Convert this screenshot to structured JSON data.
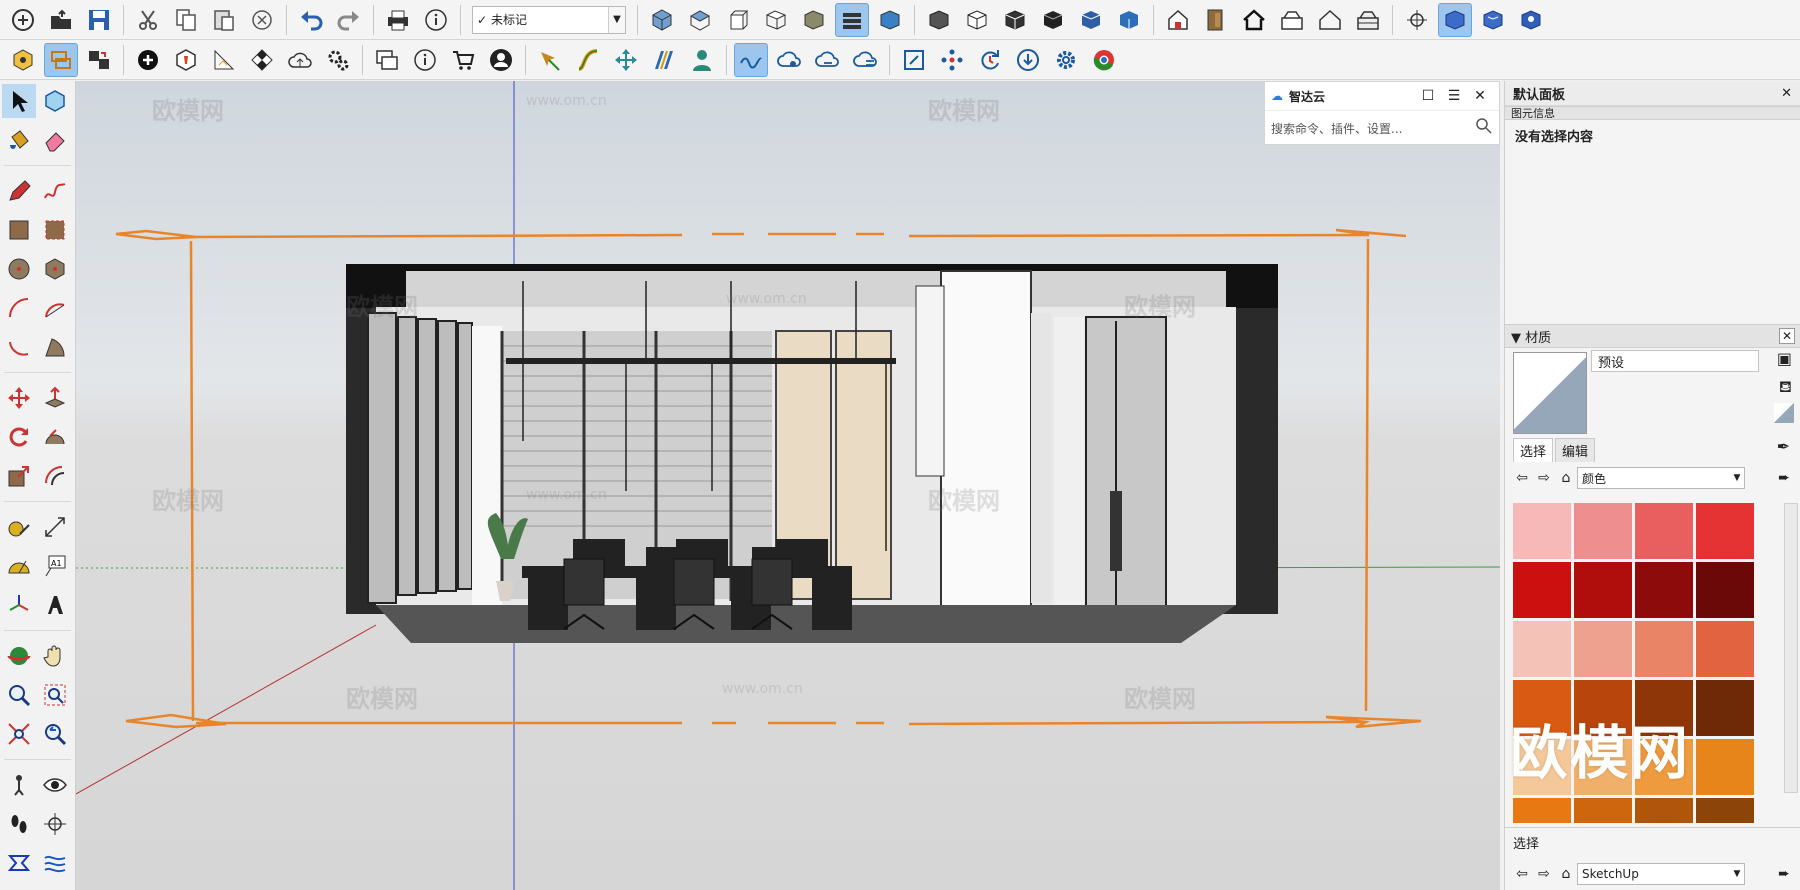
{
  "toolbar_top": {
    "tag_selector": {
      "check": "✓",
      "value": "未标记"
    },
    "icons": [
      "new-icon",
      "open-icon",
      "save-icon",
      "cut-icon",
      "copy-icon",
      "paste-icon",
      "erase-selection-icon",
      "undo-icon",
      "redo-icon",
      "print-icon",
      "model-info-icon",
      "iso-view-icon",
      "top-view-icon",
      "front-view-icon",
      "right-view-icon",
      "back-view-icon",
      "left-view-icon",
      "bottom-view-icon",
      "xray-icon",
      "back-edges-icon",
      "wireframe-icon",
      "hidden-line-icon",
      "shaded-icon",
      "shaded-textures-icon",
      "monochrome-icon",
      "warehouse-icon",
      "component-icon",
      "house-icon",
      "outer-shell-icon",
      "house-outline-icon",
      "ground-icon",
      "section-plane-icon",
      "display-sections-icon",
      "section-cuts-icon",
      "section-fill-icon"
    ]
  },
  "toolbar_second": {
    "icons": [
      "solid-tools-icon",
      "swap-icon",
      "follow-icon",
      "add-location-icon",
      "extension-icon",
      "shadow-icon",
      "checker-icon",
      "cloud-upload-icon",
      "settings-gears-icon",
      "layout-icon",
      "info-icon",
      "cart-icon",
      "account-icon",
      "pin-icon",
      "curve-icon",
      "move-arrows-icon",
      "outliner-icon",
      "person-icon",
      "cloud-link-icon",
      "cloud-share-icon",
      "cloud-sync-icon",
      "cloud-list-icon",
      "frame-icon",
      "dots-icon",
      "refresh-icon",
      "download-icon",
      "gear-icon",
      "chrome-icon"
    ]
  },
  "left_tools": {
    "icons": [
      "select-icon",
      "make-component-icon",
      "paint-bucket-icon",
      "eraser-icon",
      "pencil-icon",
      "freehand-icon",
      "rectangle-icon",
      "rotated-rectangle-icon",
      "circle-icon",
      "polygon-icon",
      "arc-icon",
      "two-point-arc-icon",
      "three-point-arc-icon",
      "pie-icon",
      "move-icon",
      "push-pull-icon",
      "rotate-icon",
      "follow-me-icon",
      "scale-icon",
      "offset-icon",
      "tape-measure-icon",
      "dimension-icon",
      "protractor-icon",
      "text-icon",
      "axes-icon",
      "3d-text-icon",
      "orbit-icon",
      "pan-icon",
      "zoom-icon",
      "zoom-window-icon",
      "zoom-extents-icon",
      "previous-view-icon",
      "position-camera-icon",
      "look-around-icon",
      "walk-icon",
      "section-plane-tool-icon",
      "sandbox-icon",
      "smoove-icon"
    ]
  },
  "zhida_cloud": {
    "title": "智达云",
    "search_placeholder": "搜索命令、插件、设置..."
  },
  "tray": {
    "title": "默认面板",
    "entity_info_header": "图元信息",
    "entity_info_text": "没有选择内容",
    "materials_header": "▼ 材质",
    "material_name": "预设",
    "tab_select": "选择",
    "tab_edit": "编辑",
    "library": "颜色",
    "footer_label": "选择",
    "footer_library": "SketchUp"
  },
  "swatch_colors": [
    [
      "#f7b8b8",
      "#ef8e8e",
      "#e95e5e",
      "#e53333"
    ],
    [
      "#cc1010",
      "#b00d0d",
      "#8e0b0b",
      "#6b0808"
    ],
    [
      "#f4c2b6",
      "#efa18f",
      "#ea8467",
      "#e26340"
    ],
    [
      "#d95a12",
      "#b8460c",
      "#8f3608",
      "#6e2a06"
    ],
    [
      "#f5c89a",
      "#f1b06a",
      "#ee9a3e",
      "#e8851a"
    ],
    [
      "#e87812",
      "#cd660c",
      "#b0560a",
      "#8c4408"
    ]
  ],
  "watermark": {
    "big": "欧模网",
    "small": "欧模网",
    "url": "www.om.cn"
  },
  "colors": {
    "orange_section": "#e8852a",
    "blue_axis": "#3a48c8",
    "red_axis": "#b53030",
    "green_axis": "#36a236"
  }
}
